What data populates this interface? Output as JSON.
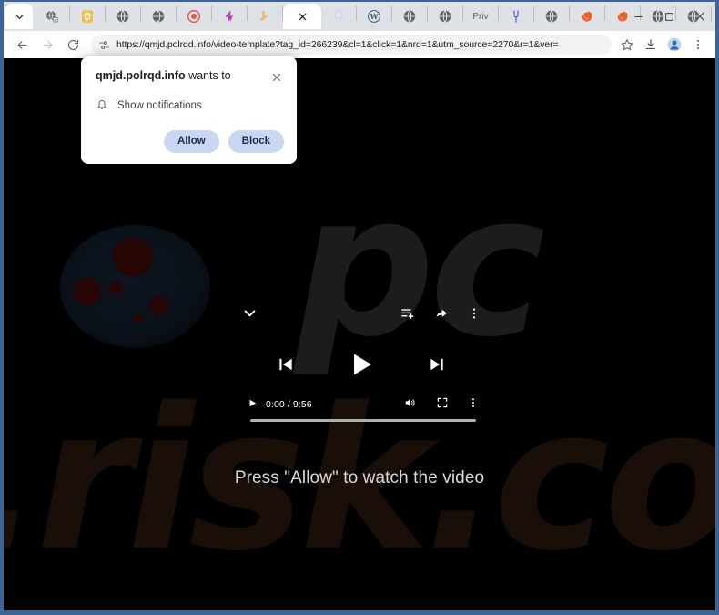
{
  "window": {
    "frame_color": "#3d6494",
    "controls": [
      {
        "name": "minimize",
        "glyph": "–"
      },
      {
        "name": "maximize",
        "glyph": "□"
      },
      {
        "name": "close",
        "glyph": "×"
      }
    ]
  },
  "tabstrip": {
    "tab_search_icon": "chevron-down-icon",
    "new_tab_label": "+",
    "tabs": [
      {
        "icon": "globe-search-icon",
        "label": "",
        "active": false
      },
      {
        "icon": "shield-orange-icon",
        "label": "",
        "active": false
      },
      {
        "icon": "globe-gray-icon",
        "label": "",
        "active": false
      },
      {
        "icon": "globe-gray-icon",
        "label": "",
        "active": false
      },
      {
        "icon": "record-red-icon",
        "label": "",
        "active": false
      },
      {
        "icon": "lightning-purple-icon",
        "label": "",
        "active": false
      },
      {
        "icon": "hand-point-icon",
        "label": "",
        "active": false
      },
      {
        "icon": "close-icon",
        "label": "",
        "active": true
      },
      {
        "icon": "bell-light-icon",
        "label": "",
        "active": false
      },
      {
        "icon": "wordpress-icon",
        "label": "",
        "active": false
      },
      {
        "icon": "globe-gray-icon",
        "label": "",
        "active": false
      },
      {
        "icon": "globe-gray-icon",
        "label": "",
        "active": false
      },
      {
        "icon": "text-label",
        "label": "Priv",
        "active": false
      },
      {
        "icon": "tuning-fork-icon",
        "label": "",
        "active": false
      },
      {
        "icon": "globe-gray-icon",
        "label": "",
        "active": false
      },
      {
        "icon": "firefox-orange-icon",
        "label": "",
        "active": false
      },
      {
        "icon": "firefox-orange-icon",
        "label": "",
        "active": false
      },
      {
        "icon": "globe-gray-icon",
        "label": "",
        "active": false
      },
      {
        "icon": "globe-gray-icon",
        "label": "",
        "active": false
      }
    ]
  },
  "toolbar": {
    "back_icon": "arrow-left-icon",
    "forward_icon": "arrow-right-icon",
    "reload_icon": "reload-icon",
    "site_settings_icon": "site-settings-icon",
    "url": "https://qmjd.polrqd.info/video-template?tag_id=266239&cl=1&click=1&nrd=1&utm_source=2270&r=1&ver=",
    "bookmark_icon": "star-icon",
    "download_icon": "download-icon",
    "profile_icon": "profile-avatar-icon",
    "menu_icon": "three-dot-menu-icon"
  },
  "permission_prompt": {
    "origin": "qmjd.polrqd.info",
    "title_suffix": " wants to",
    "request_label": "Show notifications",
    "request_icon": "bell-icon",
    "close_icon": "close-icon",
    "allow_label": "Allow",
    "block_label": "Block",
    "button_bg": "#c9d7f2",
    "button_fg": "#1b2a52"
  },
  "page": {
    "background_color": "#000000",
    "watermark_top": "pc",
    "watermark_bottom": ".risk.com",
    "hint_text": "Press \"Allow\" to watch the video",
    "video": {
      "collapse_icon": "chevron-down-icon",
      "playlist_add_icon": "playlist-add-icon",
      "share_icon": "share-arrow-icon",
      "overflow_icon": "three-dot-menu-icon",
      "previous_icon": "skip-previous-icon",
      "play_icon": "play-icon",
      "next_icon": "skip-next-icon",
      "small_play_icon": "play-small-icon",
      "current_time": "0:00",
      "duration": "9:56",
      "time_display": "0:00 / 9:56",
      "volume_icon": "volume-icon",
      "fullscreen_icon": "fullscreen-icon",
      "more_icon": "three-dot-menu-icon",
      "progress_percent": 0
    }
  }
}
